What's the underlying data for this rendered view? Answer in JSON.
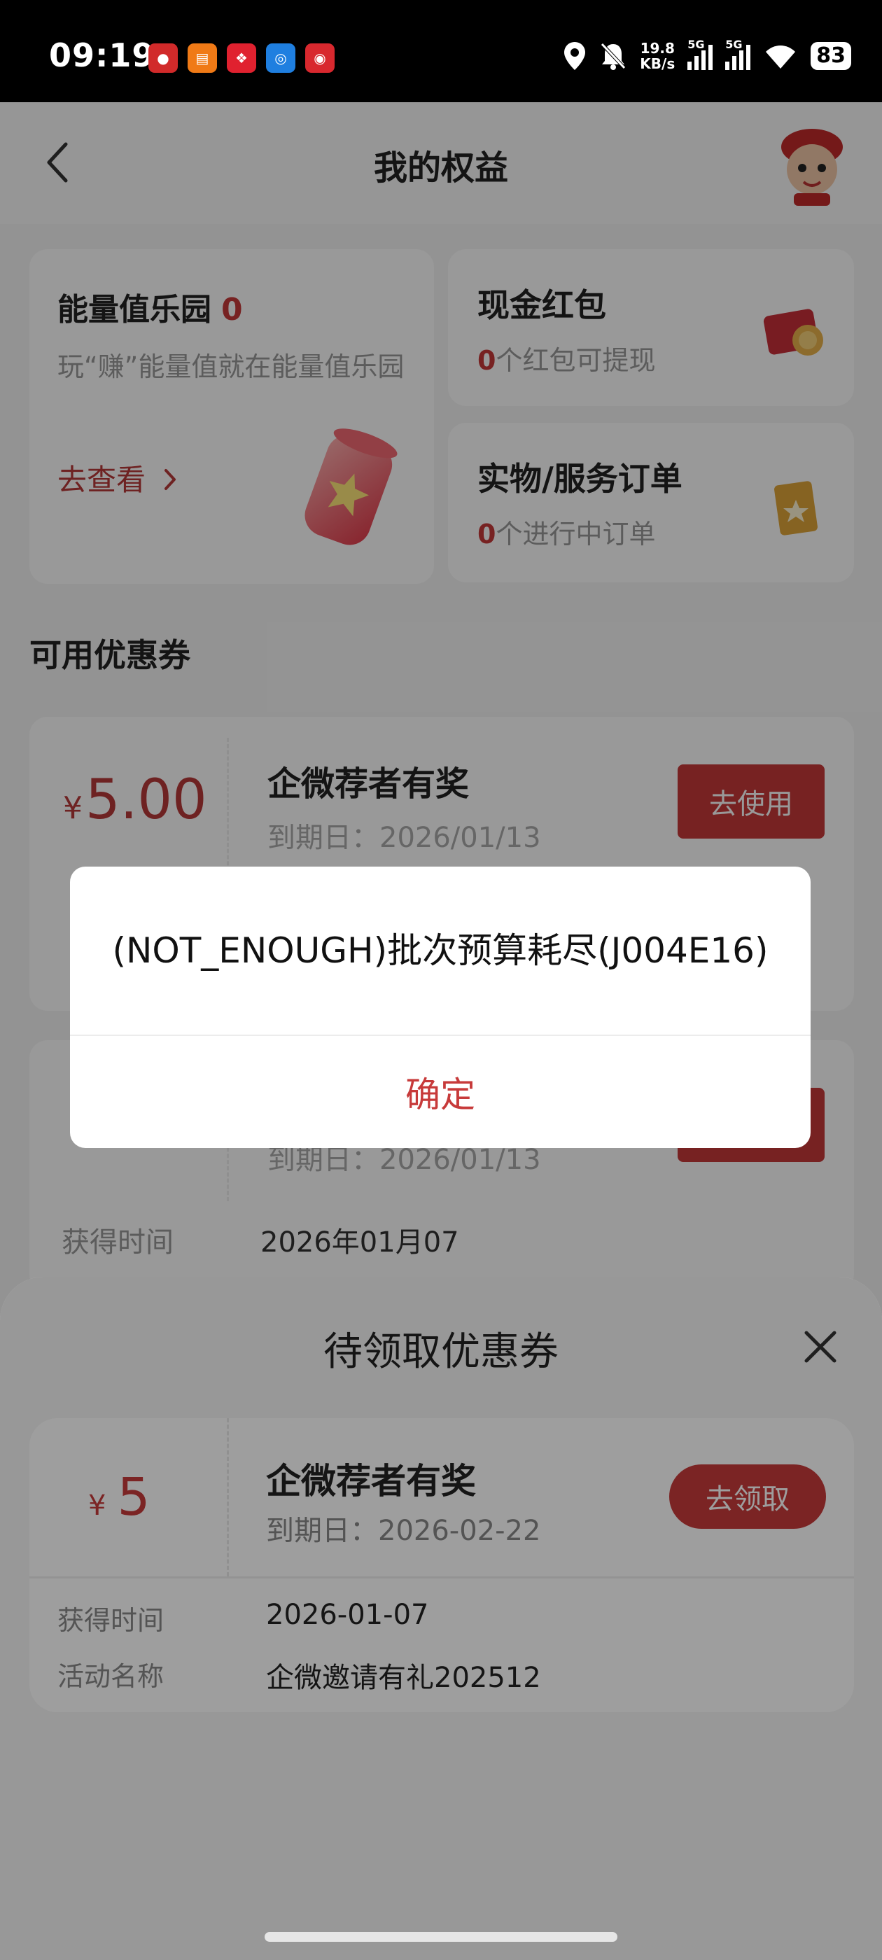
{
  "status_bar": {
    "time": "09:19",
    "net_speed_value": "19.8",
    "net_speed_unit": "KB/s",
    "sig1_label": "5G",
    "sig2_label": "5G",
    "battery": "83",
    "app_icons": [
      "app-1-icon",
      "app-2-icon",
      "app-3-icon",
      "app-4-icon",
      "app-5-icon"
    ],
    "icons": [
      "location-icon",
      "mute-bell-icon",
      "wifi-icon"
    ]
  },
  "header": {
    "title": "我的权益"
  },
  "energy_card": {
    "title": "能量值乐园",
    "count": "0",
    "desc": "玩“赚”能量值就在能量值乐园",
    "link": "去查看"
  },
  "cash_card": {
    "title": "现金红包",
    "count": "0",
    "suffix": "个红包可提现"
  },
  "order_card": {
    "title": "实物/服务订单",
    "count": "0",
    "suffix": "个进行中订单"
  },
  "section": {
    "available_title": "可用优惠券"
  },
  "coupons": [
    {
      "yen": "¥",
      "amount": "5.00",
      "title": "企微荐者有奖",
      "expire": "到期日：2026/01/13",
      "button": "去使用"
    },
    {
      "expire": "到期日：2026/01/13",
      "obtain_label": "获得时间",
      "obtain_value": "2026年01月07"
    }
  ],
  "modal": {
    "message": "(NOT_ENOUGH)批次预算耗尽(J004E16)",
    "confirm": "确定"
  },
  "sheet": {
    "title": "待领取优惠券",
    "coupon": {
      "yen": "¥",
      "amount": "5",
      "title": "企微荐者有奖",
      "expire": "到期日：2026-02-22",
      "button": "去领取",
      "obtain_label": "获得时间",
      "obtain_value": "2026-01-07",
      "activity_label": "活动名称",
      "activity_value": "企微邀请有礼202512"
    }
  },
  "colors": {
    "accent": "#c73a3a",
    "overlay": "rgba(0,0,0,0.4)"
  }
}
